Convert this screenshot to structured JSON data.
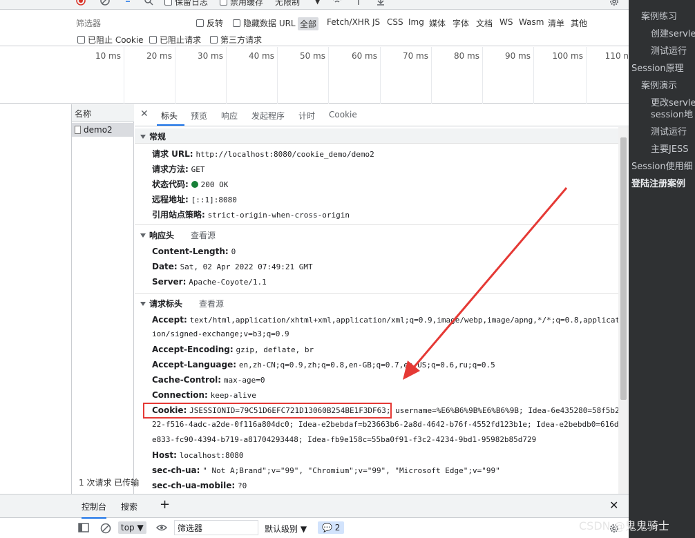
{
  "toolbar": {
    "preserve_log": "保留日志",
    "disable_cache": "禁用缓存",
    "throttle": "无限制"
  },
  "filter": {
    "placeholder": "筛选器",
    "invert": "反转",
    "hide_data_urls": "隐藏数据 URL",
    "types": [
      "全部",
      "Fetch/XHR",
      "JS",
      "CSS",
      "Img",
      "媒体",
      "字体",
      "文档",
      "WS",
      "Wasm",
      "清单",
      "其他"
    ],
    "blocked_cookies": "已阻止 Cookie",
    "blocked_requests": "已阻止请求",
    "third_party": "第三方请求"
  },
  "timeline": {
    "ticks": [
      "10 ms",
      "20 ms",
      "30 ms",
      "40 ms",
      "50 ms",
      "60 ms",
      "70 ms",
      "80 ms",
      "90 ms",
      "100 ms",
      "110 n"
    ]
  },
  "requests": {
    "header": "名称",
    "rows": [
      "demo2"
    ],
    "status": "1 次请求  已传输"
  },
  "detail": {
    "tabs": [
      "标头",
      "预览",
      "响应",
      "发起程序",
      "计时",
      "Cookie"
    ],
    "general": {
      "title": "常规",
      "rows": [
        {
          "k": "请求 URL:",
          "v": "http://localhost:8080/cookie_demo/demo2"
        },
        {
          "k": "请求方法:",
          "v": "GET"
        },
        {
          "k": "状态代码:",
          "v": "200 OK"
        },
        {
          "k": "远程地址:",
          "v": "[::1]:8080"
        },
        {
          "k": "引用站点策略:",
          "v": "strict-origin-when-cross-origin"
        }
      ]
    },
    "response_headers": {
      "title": "响应头",
      "view_source": "查看源",
      "rows": [
        {
          "k": "Content-Length:",
          "v": "0"
        },
        {
          "k": "Date:",
          "v": "Sat, 02 Apr 2022 07:49:21 GMT"
        },
        {
          "k": "Server:",
          "v": "Apache-Coyote/1.1"
        }
      ]
    },
    "request_headers": {
      "title": "请求标头",
      "view_source": "查看源",
      "accept_k": "Accept:",
      "accept_v1": "text/html,application/xhtml+xml,application/xml;q=0.9,image/webp,image/apng,*/*;q=0.8,applicat",
      "accept_v2": "ion/signed-exchange;v=b3;q=0.9",
      "accept_encoding_k": "Accept-Encoding:",
      "accept_encoding_v": "gzip, deflate, br",
      "accept_language_k": "Accept-Language:",
      "accept_language_v": "en,zh-CN;q=0.9,zh;q=0.8,en-GB;q=0.7,en-US;q=0.6,ru;q=0.5",
      "cache_control_k": "Cache-Control:",
      "cache_control_v": "max-age=0",
      "connection_k": "Connection:",
      "connection_v": "keep-alive",
      "cookie_k": "Cookie:",
      "cookie_v1": "JSESSIONID=79C51D6EFC721D13060B254BE1F3DF63; username=%E6%B6%9B%E6%B6%9B; Idea-6e435280=58f5b2",
      "cookie_v2": "22-f516-4adc-a2de-0f116a804dc0; Idea-e2bebdaf=b23663b6-2a8d-4642-b76f-4552fd123b1e; Idea-e2bebdb0=616d",
      "cookie_v3": "e833-fc90-4394-b719-a81704293448; Idea-fb9e158c=55ba0f91-f3c2-4234-9bd1-95982b85d729",
      "host_k": "Host:",
      "host_v": "localhost:8080",
      "sec_ch_ua_k": "sec-ch-ua:",
      "sec_ch_ua_v": "\" Not A;Brand\";v=\"99\", \"Chromium\";v=\"99\", \"Microsoft Edge\";v=\"99\"",
      "sec_ch_ua_mobile_k": "sec-ch-ua-mobile:",
      "sec_ch_ua_mobile_v": "?0"
    }
  },
  "drawer": {
    "tabs": [
      "控制台",
      "搜索"
    ],
    "context": "top",
    "filter_placeholder": "筛选器",
    "level": "默认级别",
    "issues": "2"
  },
  "right_sidebar": {
    "items": [
      "案例练习",
      "创建servle",
      "测试运行",
      "Session原理",
      "案例演示",
      "更改servle",
      "session地",
      "测试运行",
      "主要JESS",
      "Session使用细",
      "登陆注册案例"
    ]
  },
  "watermark": "CSDN @鬼鬼骑士",
  "colors": {
    "accent": "#1a73e8",
    "highlight_box": "#e53935",
    "status_ok": "#188038",
    "sidebar_bg": "#2f3133"
  }
}
